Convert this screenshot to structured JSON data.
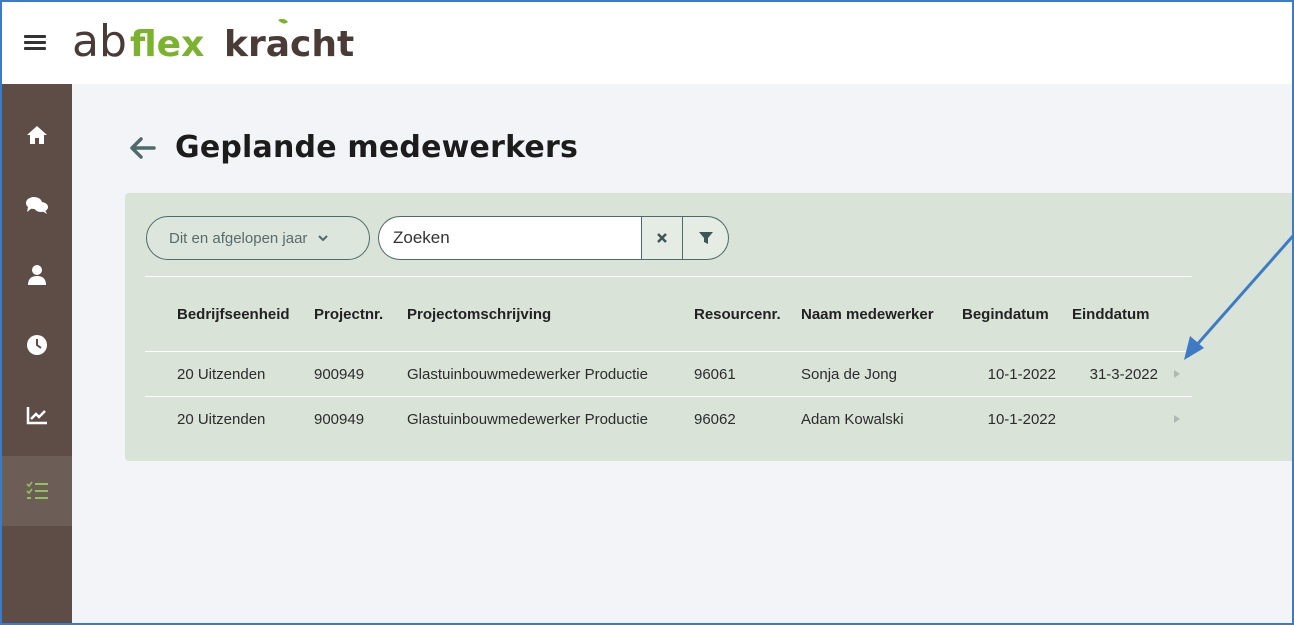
{
  "app": {
    "logo_ab": "ab",
    "logo_flex": "flex",
    "logo_kracht": "kracht"
  },
  "sidebar": {
    "items": [
      {
        "name": "home-icon"
      },
      {
        "name": "chat-icon"
      },
      {
        "name": "user-icon"
      },
      {
        "name": "clock-icon"
      },
      {
        "name": "chart-icon"
      },
      {
        "name": "checklist-icon",
        "active": true
      }
    ]
  },
  "page": {
    "title": "Geplande medewerkers"
  },
  "filters": {
    "period_value": "Dit en afgelopen jaar",
    "search_placeholder": "Zoeken"
  },
  "table": {
    "columns": [
      "Bedrijfseenheid",
      "Projectnr.",
      "Projectomschrijving",
      "Resourcenr.",
      "Naam medewerker",
      "Begindatum",
      "Einddatum"
    ],
    "rows": [
      [
        "20 Uitzenden",
        "900949",
        "Glastuinbouwmedewerker Productie",
        "96061",
        "Sonja de Jong",
        "10-1-2022",
        "31-3-2022"
      ],
      [
        "20 Uitzenden",
        "900949",
        "Glastuinbouwmedewerker Productie",
        "96062",
        "Adam Kowalski",
        "10-1-2022",
        ""
      ]
    ]
  },
  "colors": {
    "sidebar": "#5e4d47",
    "panel": "#d9e3d8",
    "accent": "#4f6a6a",
    "logo_green": "#7bb22e",
    "annotation_arrow": "#3d7bc4"
  }
}
